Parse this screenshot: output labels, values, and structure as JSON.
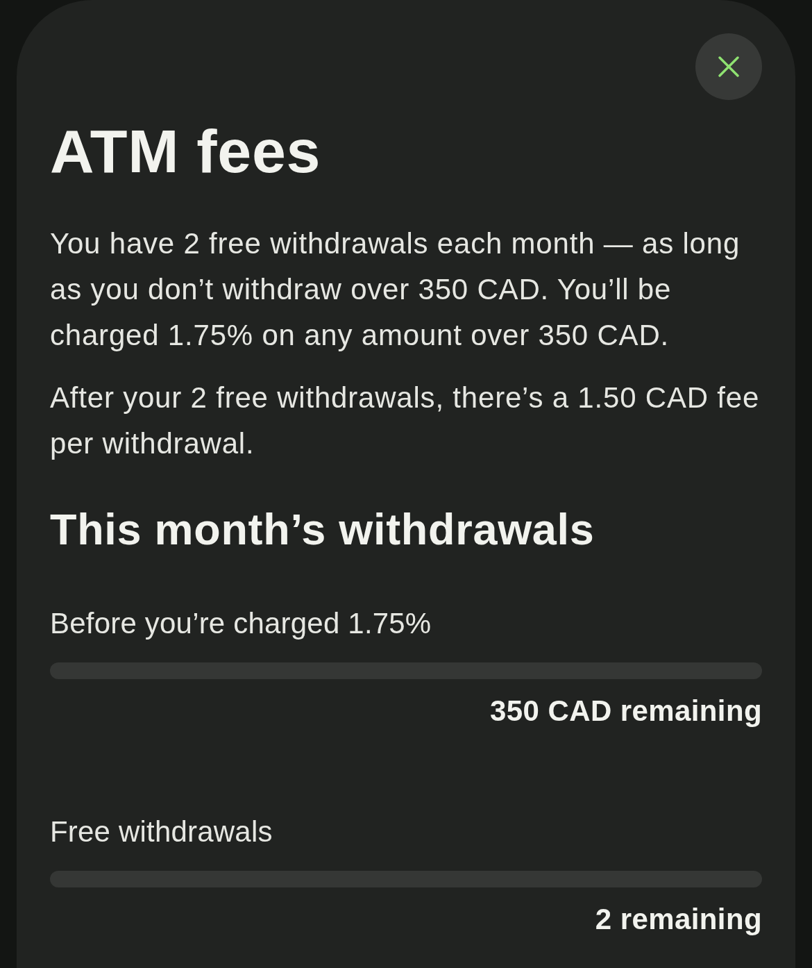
{
  "sheet": {
    "title": "ATM fees",
    "paragraphs": [
      "You have 2 free withdrawals each month — as long as you don’t withdraw over 350 CAD. You’ll be charged 1.75% on any amount over 350 CAD.",
      "After your 2 free withdrawals, there’s a 1.50 CAD fee per withdrawal."
    ],
    "section_title": "This month’s withdrawals",
    "meters": [
      {
        "label": "Before you’re charged 1.75%",
        "level": 0,
        "reading": "350 CAD remaining"
      },
      {
        "label": "Free withdrawals",
        "level": 0,
        "reading": "2 remaining"
      }
    ]
  }
}
